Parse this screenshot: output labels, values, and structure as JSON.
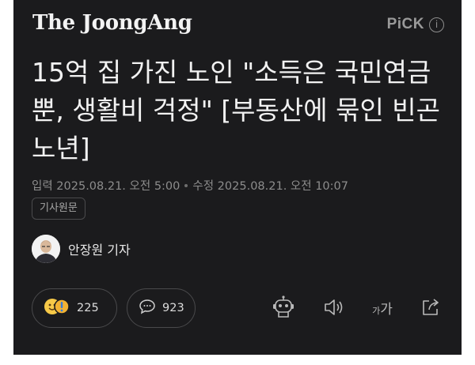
{
  "header": {
    "brand": "The JoongAng",
    "pick_label": "PiCK",
    "info_icon": "info-icon"
  },
  "article": {
    "headline": "15억 집 가진 노인 \"소득은 국민연금뿐, 생활비 걱정\" [부동산에 묶인 빈곤 노년]",
    "published": "입력 2025.08.21. 오전 5:00",
    "modified": "수정 2025.08.21. 오전 10:07",
    "tag": "기사원문",
    "reporter": "안장원 기자"
  },
  "engagement": {
    "reactions": "225",
    "comments": "923"
  },
  "toolbar": {
    "font_size_small": "가",
    "font_size_large": "가"
  },
  "colors": {
    "background": "#1b1b1d",
    "text": "#f2f2f2",
    "muted": "#8d8d8d",
    "border": "#49494b"
  }
}
